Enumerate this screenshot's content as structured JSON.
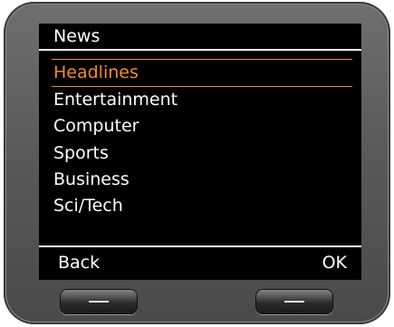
{
  "header": {
    "title": "News"
  },
  "menu": {
    "items": [
      {
        "label": "Headlines",
        "selected": true
      },
      {
        "label": "Entertainment",
        "selected": false
      },
      {
        "label": "Computer",
        "selected": false
      },
      {
        "label": "Sports",
        "selected": false
      },
      {
        "label": "Business",
        "selected": false
      },
      {
        "label": "Sci/Tech",
        "selected": false
      }
    ]
  },
  "softkeys": {
    "left_label": "Back",
    "right_label": "OK"
  },
  "colors": {
    "selection": "#f08b2a",
    "screen_background": "#000000",
    "text": "#ffffff",
    "bezel": "#5a5a5a"
  },
  "icons": {
    "hardware_button_mark": "dash-icon"
  }
}
